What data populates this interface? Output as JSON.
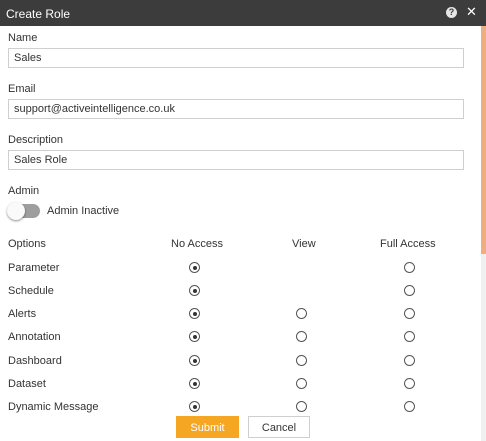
{
  "dialog": {
    "title": "Create Role"
  },
  "form": {
    "name": {
      "label": "Name",
      "value": "Sales"
    },
    "email": {
      "label": "Email",
      "value": "support@activeintelligence.co.uk"
    },
    "description": {
      "label": "Description",
      "value": "Sales Role"
    },
    "admin": {
      "label": "Admin",
      "toggle_label": "Admin Inactive",
      "enabled": false
    }
  },
  "options": {
    "headers": [
      "Options",
      "No Access",
      "View",
      "Full Access"
    ],
    "rows": [
      {
        "label": "Parameter",
        "selected": "No Access"
      },
      {
        "label": "Schedule",
        "selected": "No Access"
      },
      {
        "label": "Alerts",
        "selected": "No Access"
      },
      {
        "label": "Annotation",
        "selected": "No Access"
      },
      {
        "label": "Dashboard",
        "selected": "No Access"
      },
      {
        "label": "Dataset",
        "selected": "No Access"
      },
      {
        "label": "Dynamic Message",
        "selected": "No Access"
      }
    ]
  },
  "buttons": {
    "submit": "Submit",
    "cancel": "Cancel"
  },
  "colors": {
    "titlebar": "#3c3c3c",
    "accent": "#f5a623",
    "scroll_thumb": "#f0ad7e"
  }
}
